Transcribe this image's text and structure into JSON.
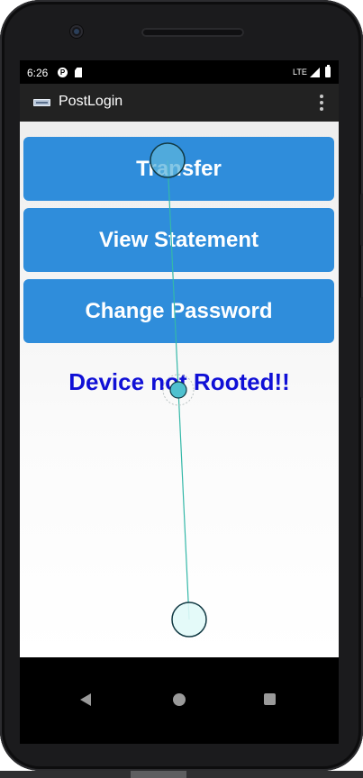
{
  "status_bar": {
    "time": "6:26",
    "network": "LTE"
  },
  "app_bar": {
    "title": "PostLogin",
    "overflow_icon": "more-vert-icon"
  },
  "buttons": {
    "transfer": "Transfer",
    "view_statement": "View Statement",
    "change_password": "Change Password"
  },
  "root_status": {
    "text": "Device not Rooted!!",
    "color": "#1010d6"
  },
  "colors": {
    "button_bg": "#2f8ddb",
    "app_bar_bg": "#222222",
    "touch_trail": "#34b8a8"
  },
  "nav_bar": {
    "back_icon": "back-triangle-icon",
    "home_icon": "home-circle-icon",
    "recents_icon": "recents-square-icon"
  }
}
